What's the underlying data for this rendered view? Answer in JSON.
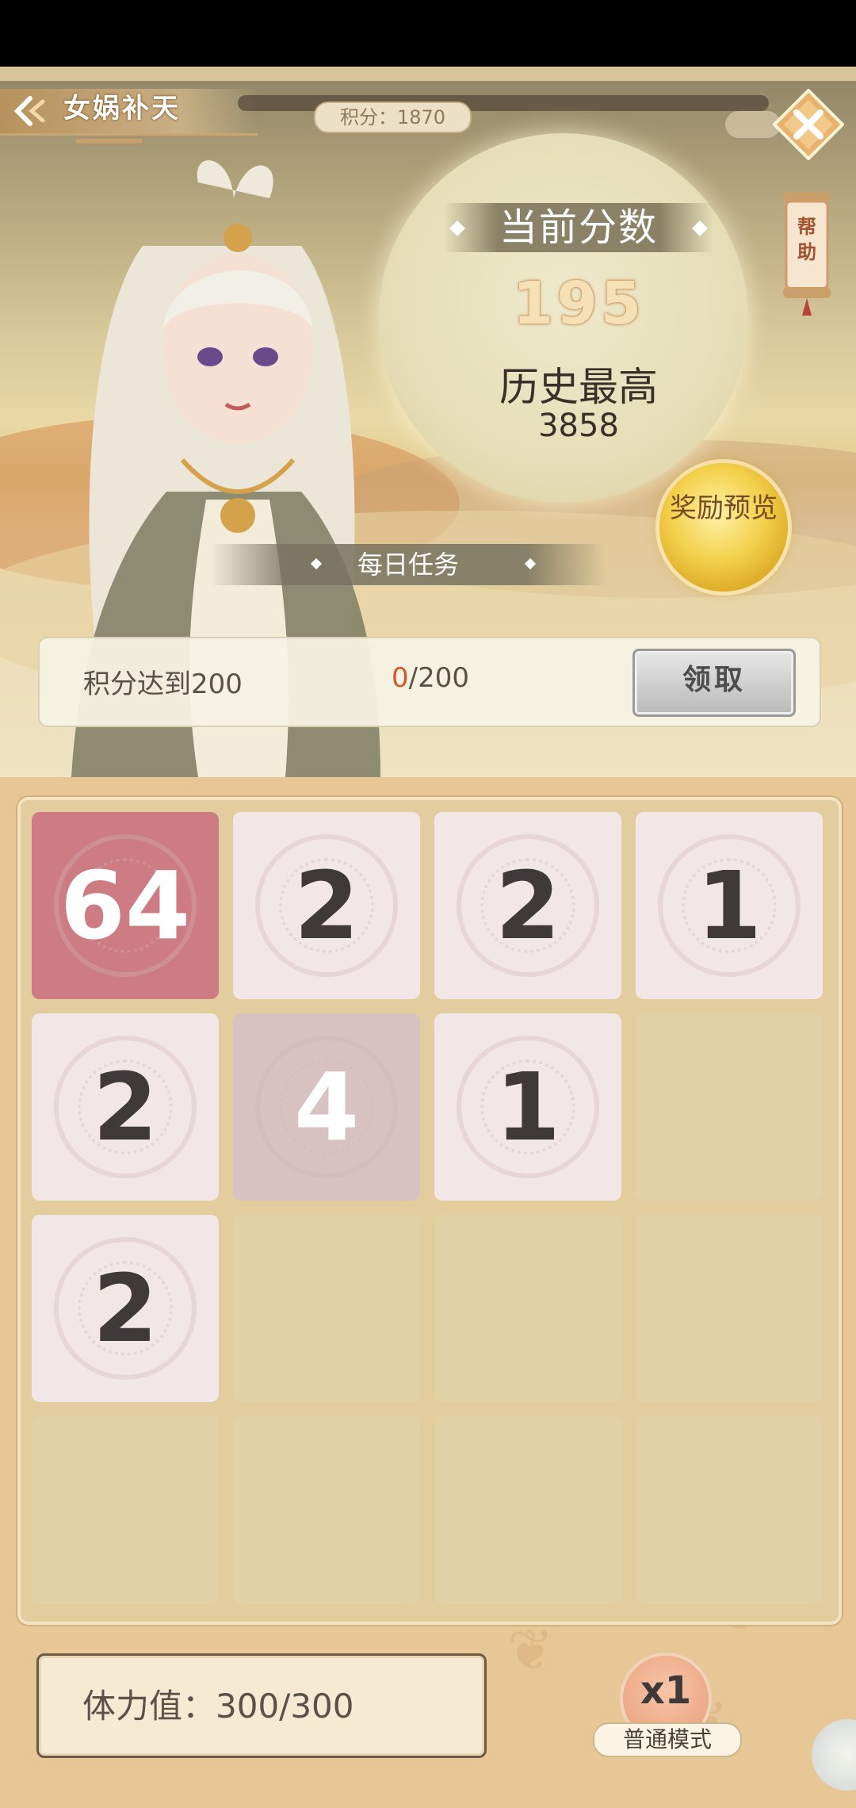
{
  "header": {
    "title": "女娲补天",
    "points": "积分：1870"
  },
  "help": {
    "label": "帮助"
  },
  "score": {
    "label": "当前分数",
    "value": "195",
    "best_label": "历史最高",
    "best_value": "3858"
  },
  "reward": {
    "label": "奖励预览"
  },
  "daily_task": {
    "title": "每日任务",
    "description": "积分达到200",
    "progress_current": "0",
    "progress_total": "/200",
    "claim_label": "领取"
  },
  "board": {
    "rows": [
      [
        "64",
        "2",
        "2",
        "1"
      ],
      [
        "2",
        "4",
        "1",
        ""
      ],
      [
        "2",
        "",
        "",
        ""
      ],
      [
        "",
        "",
        "",
        ""
      ]
    ]
  },
  "stamina": {
    "text": "体力值：300/300"
  },
  "mode": {
    "multiplier": "x1",
    "label": "普通模式"
  },
  "colors": {
    "tile_light": "#f3e6e6",
    "tile_mid": "#d8c2c1",
    "tile_dark": "#cc7c82",
    "board": "#e3cc9d",
    "accent": "#d0582d"
  }
}
